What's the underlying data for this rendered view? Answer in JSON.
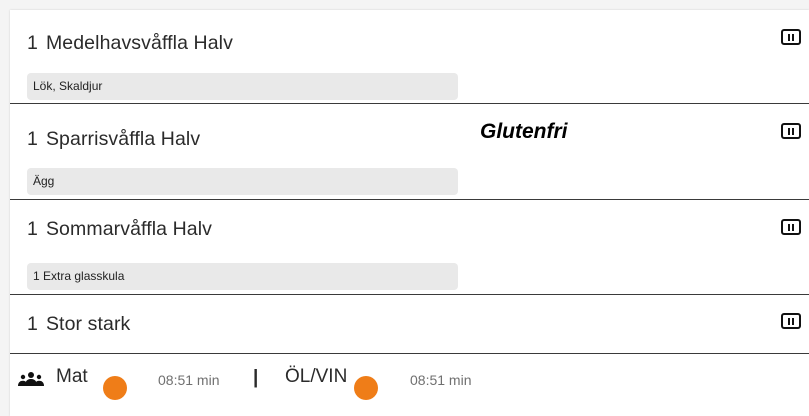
{
  "orders": [
    {
      "qty": "1",
      "name": "Medelhavsvåffla Halv",
      "note": "Lök, Skaldjur"
    },
    {
      "qty": "1",
      "name": "Sparrisvåffla Halv",
      "note": "Ägg"
    },
    {
      "qty": "1",
      "name": "Sommarvåffla Halv",
      "note": "1 Extra glasskula"
    },
    {
      "qty": "1",
      "name": "Stor stark",
      "note": ""
    }
  ],
  "tag": {
    "glutenfri": "Glutenfri"
  },
  "footer": {
    "food_label": "Mat",
    "food_time": "08:51 min",
    "separator": "|",
    "drinks_label": "ÖL/VIN",
    "drinks_time": "08:51 min"
  },
  "icons": {
    "pause": "pause-icon",
    "people": "people-icon",
    "status": "status-dot"
  },
  "colors": {
    "status_dot": "#ef7d18",
    "note_bg": "#e9e9e9",
    "divider": "#3a3a3a"
  }
}
